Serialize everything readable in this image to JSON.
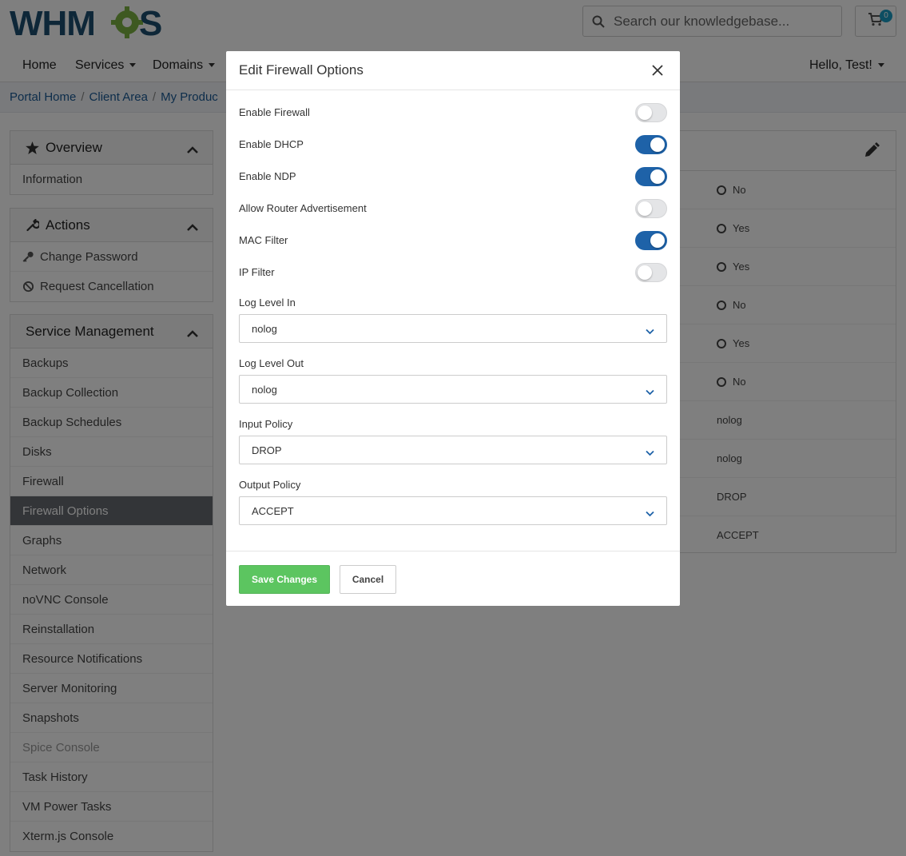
{
  "header": {
    "logo_text": "WHMCS",
    "search_placeholder": "Search our knowledgebase...",
    "cart_count": "0"
  },
  "nav": {
    "items": [
      "Home",
      "Services",
      "Domains"
    ],
    "user": "Hello, Test!"
  },
  "breadcrumb": [
    "Portal Home",
    "Client Area",
    "My Produc"
  ],
  "sidebar": {
    "overview": {
      "title": "Overview",
      "items": [
        "Information"
      ]
    },
    "actions": {
      "title": "Actions",
      "items": [
        "Change Password",
        "Request Cancellation"
      ]
    },
    "management": {
      "title": "Service Management",
      "items": [
        "Backups",
        "Backup Collection",
        "Backup Schedules",
        "Disks",
        "Firewall",
        "Firewall Options",
        "Graphs",
        "Network",
        "noVNC Console",
        "Reinstallation",
        "Resource Notifications",
        "Server Monitoring",
        "Snapshots",
        "Spice Console",
        "Task History",
        "VM Power Tasks",
        "Xterm.js Console"
      ],
      "active": "Firewall Options"
    }
  },
  "card": {
    "values": [
      "No",
      "Yes",
      "Yes",
      "No",
      "Yes",
      "No",
      "nolog",
      "nolog",
      "DROP",
      "ACCEPT"
    ]
  },
  "modal": {
    "title": "Edit Firewall Options",
    "toggles": [
      {
        "label": "Enable Firewall",
        "on": false
      },
      {
        "label": "Enable DHCP",
        "on": true
      },
      {
        "label": "Enable NDP",
        "on": true
      },
      {
        "label": "Allow Router Advertisement",
        "on": false
      },
      {
        "label": "MAC Filter",
        "on": true
      },
      {
        "label": "IP Filter",
        "on": false
      }
    ],
    "selects": [
      {
        "label": "Log Level In",
        "value": "nolog"
      },
      {
        "label": "Log Level Out",
        "value": "nolog"
      },
      {
        "label": "Input Policy",
        "value": "DROP"
      },
      {
        "label": "Output Policy",
        "value": "ACCEPT"
      }
    ],
    "save_label": "Save Changes",
    "cancel_label": "Cancel"
  },
  "colors": {
    "toggle_on": "#1e62a8",
    "save_button": "#5cc560",
    "no_red": "#d9534f",
    "yes_green": "#5cb85c",
    "active_item": "#666b70"
  }
}
